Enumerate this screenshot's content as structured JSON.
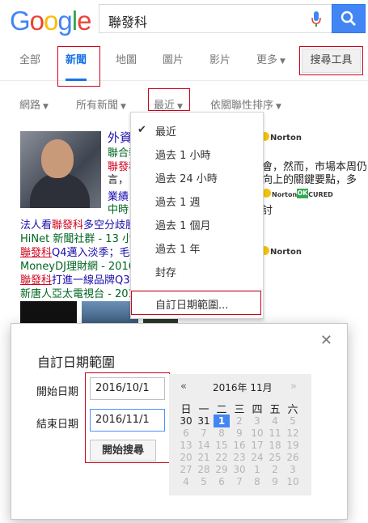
{
  "search": {
    "query": "聯發科"
  },
  "tabs": [
    {
      "label": "全部"
    },
    {
      "label": "新聞"
    },
    {
      "label": "地圖"
    },
    {
      "label": "圖片"
    },
    {
      "label": "影片"
    },
    {
      "label": "更多"
    }
  ],
  "tools_label": "搜尋工具",
  "filters": [
    {
      "label": "網路"
    },
    {
      "label": "所有新聞"
    },
    {
      "label": "最近"
    },
    {
      "label": "依關聯性排序"
    }
  ],
  "results": {
    "r1_title": "外資",
    "r1_src": "聯合報",
    "r1_snip_a": "聯發科",
    "r1_snip_b": "言，",
    "r1_right_a": "會，然而，市場本周仍",
    "r1_right_b": "向上的關鍵要點，多",
    "r1_line_a": "業績",
    "r1_line_b": "中時",
    "r1_right_c": "討",
    "r2_hl": "聯發科",
    "r2_pre": "法人看",
    "r2_post": "多空分歧股",
    "r2_src": "HiNet 新聞社群 - 13 小",
    "r3_hl": "聯發科",
    "r3_post": "Q4邁入淡季；毛",
    "r3_src": "MoneyDJ理財網 - 2016",
    "r4_hl": "聯發科",
    "r4_post": "打進一線品牌Q3",
    "r4_src": "新唐人亞太電視台 - 201",
    "norton": "Norton",
    "norton_secured": "Norton SECURED",
    "ok": "OK"
  },
  "menu": {
    "items": [
      "最近",
      "過去 1 小時",
      "過去 24 小時",
      "過去 1 週",
      "過去 1 個月",
      "過去 1 年",
      "封存"
    ],
    "custom": "自訂日期範圍..."
  },
  "dialog": {
    "title": "自訂日期範圍",
    "start_label": "開始日期",
    "start_value": "2016/10/1",
    "end_label": "結束日期",
    "end_value": "2016/11/1",
    "submit": "開始搜尋"
  },
  "calendar": {
    "prev": "«",
    "next": "»",
    "month": "2016年 11月",
    "dow": [
      "日",
      "一",
      "二",
      "三",
      "四",
      "五",
      "六"
    ],
    "weeks": [
      [
        "30",
        "31",
        "1",
        "2",
        "3",
        "4",
        "5"
      ],
      [
        "6",
        "7",
        "8",
        "9",
        "10",
        "11",
        "12"
      ],
      [
        "13",
        "14",
        "15",
        "16",
        "17",
        "18",
        "19"
      ],
      [
        "20",
        "21",
        "22",
        "23",
        "24",
        "25",
        "26"
      ],
      [
        "27",
        "28",
        "29",
        "30",
        "1",
        "2",
        "3"
      ],
      [
        "4",
        "5",
        "6",
        "7",
        "8",
        "9",
        "10"
      ]
    ],
    "selected": "1"
  },
  "colors": {
    "accent": "#4285f4",
    "highlight_box": "#d0021b",
    "link": "#1a0dab",
    "source": "#006621"
  }
}
